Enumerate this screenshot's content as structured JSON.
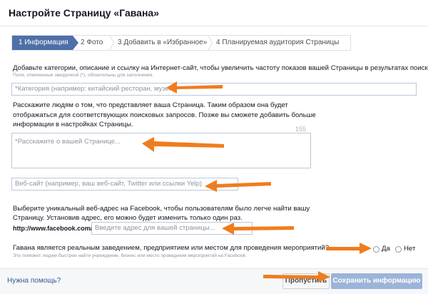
{
  "dialog": {
    "title": "Настройте Страницу «Гавана»"
  },
  "steps": [
    {
      "label": "1 Информация",
      "active": true
    },
    {
      "label": "2 Фото",
      "active": false
    },
    {
      "label": "3 Добавить в «Избранное»",
      "active": false
    },
    {
      "label": "4 Планируемая аудитория Страницы",
      "active": false
    }
  ],
  "intro": {
    "text": "Добавьте категории, описание и ссылку на Интернет-сайт, чтобы увеличить частоту показов вашей Страницы в результатах поиска.",
    "required_note": "Поля, отмеченные звездочкой (*), обязательны для заполнения."
  },
  "category": {
    "placeholder": "*Категория (например: китайский ресторан, музей)"
  },
  "about": {
    "text_line1": "Расскажите людям о том, что представляет ваша Страница. Таким образом она будет",
    "text_line2": "отображаться для соответствующих поисковых запросов. Позже вы сможете добавить больше",
    "text_line3": "информации в настройках Страницы.",
    "counter": "155",
    "placeholder": "*Расскажите о вашей Странице..."
  },
  "website": {
    "placeholder": "Веб-сайт (например, ваш веб-сайт, Twitter или ссылки Yelp)"
  },
  "address": {
    "text_line1": "Выберите уникальный веб-адрес на Facebook, чтобы пользователям было легче найти вашу",
    "text_line2": "Страницу. Установив адрес, его можно будет изменить только один раз.",
    "prefix": "http://www.facebook.com/",
    "placeholder": "Введите адрес для вашей страницы..."
  },
  "venue": {
    "question": "Гавана является реальным заведением, предприятием или местом для проведения мероприятий?",
    "hint": "Это поможет людям быстрее найти учреждение, бизнес или место проведения мероприятий на Facebook.",
    "yes_label": "Да",
    "no_label": "Нет"
  },
  "footer": {
    "help_link": "Нужна помощь?",
    "skip_button": "Пропустить",
    "save_button": "Сохранить информацию"
  },
  "colors": {
    "arrow": "#f07c1d",
    "active_step": "#4f6fa8",
    "save_button": "#9cb4d8"
  }
}
